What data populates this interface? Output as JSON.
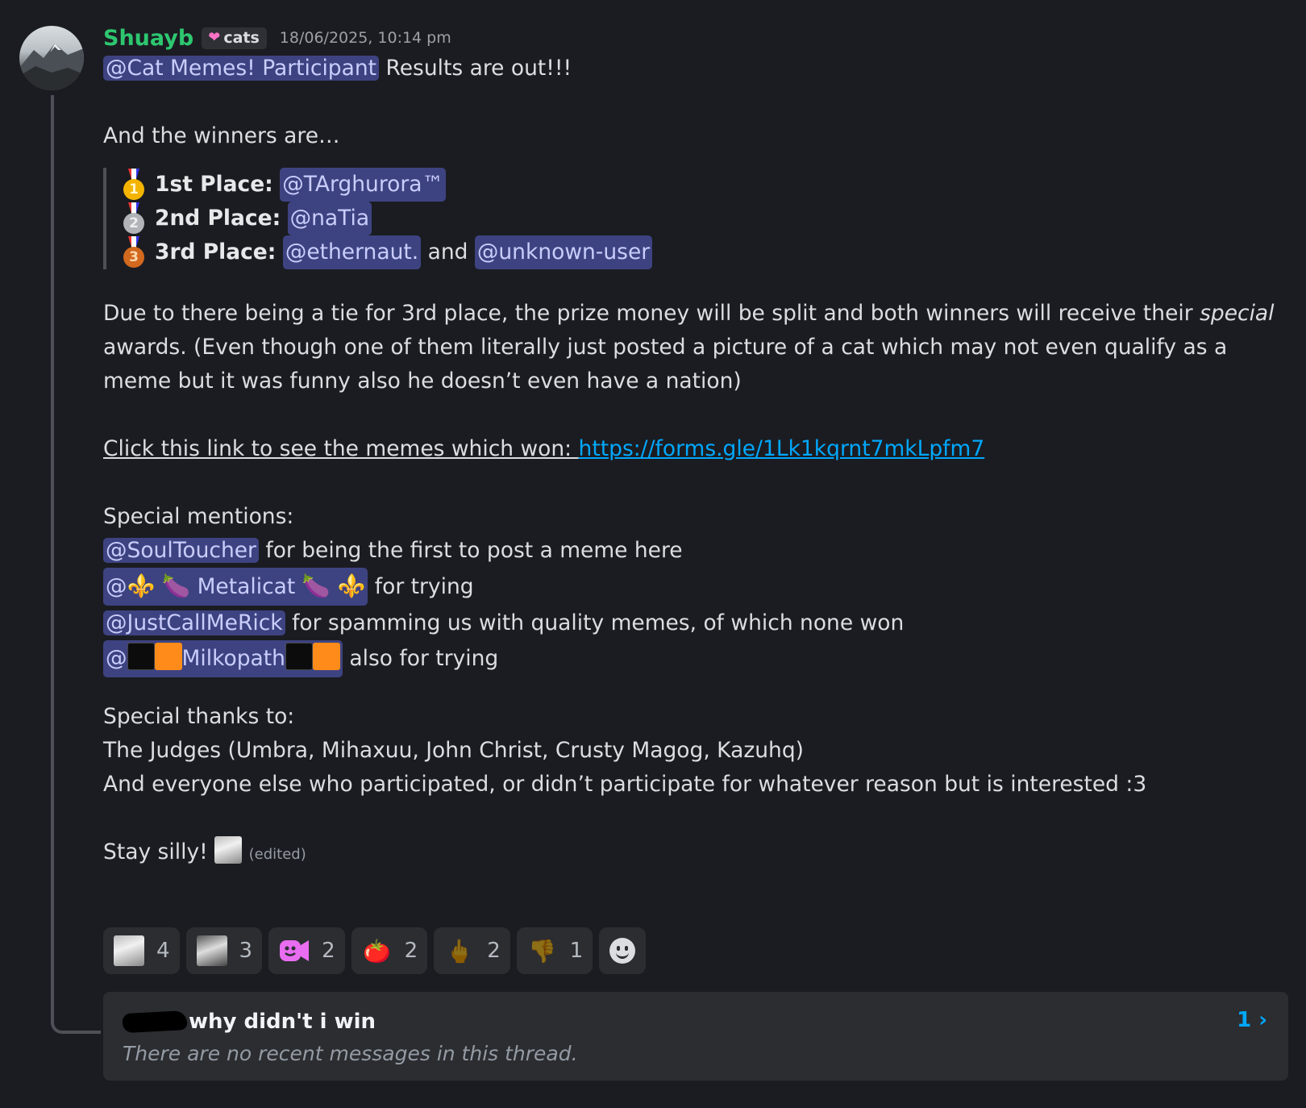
{
  "author": {
    "name": "Shuayb",
    "tag": "cats",
    "timestamp": "18/06/2025, 10:14 pm"
  },
  "message": {
    "intro_mention": "@Cat Memes! Participant",
    "intro_text": " Results are out!!!",
    "winners_intro": "And the winners are…",
    "places": [
      {
        "medal": "1",
        "label": "1st Place:",
        "mention": "@TArghurora™"
      },
      {
        "medal": "2",
        "label": "2nd Place:",
        "mention": "@naTia"
      },
      {
        "medal": "3",
        "label": "3rd Place:",
        "mention": "@ethernaut.",
        "joiner": " and ",
        "mention2": "@unknown-user"
      }
    ],
    "tie_text_1": "Due to there being a tie for 3rd place, the prize money will be split and both winners will receive their ",
    "tie_italic": "special",
    "tie_text_2": "awards. (Even though one of them literally just posted a picture of a cat which may not even qualify as a",
    "tie_text_3": "meme but it was funny also he doesn’t even have a nation)",
    "link_prefix": "Click this link to see the memes which won: ",
    "link_url": "https://forms.gle/1Lk1kqrnt7mkLpfm7",
    "special_mentions_heading": "Special mentions:",
    "mentions": [
      {
        "mention": "@SoulToucher",
        "text": " for being the first to post a meme here"
      },
      {
        "mention_prefix": "@",
        "mention_glyph": "⚜️ 🍆",
        "mention_name": " Metalicat ",
        "mention_glyph2": "🍆 ⚜️",
        "text": " for trying"
      },
      {
        "mention": "@JustCallMeRick",
        "text": " for spamming us with quality memes, of which none won"
      },
      {
        "mention_prefix": "@",
        "mention_name": "Milkopath",
        "text": " also for trying"
      }
    ],
    "thanks_heading": "Special thanks to:",
    "thanks_judges": "The Judges (Umbra, Mihaxuu, John Christ, Crusty Magog, Kazuhq)",
    "thanks_everyone": "And everyone else who participated, or didn’t participate for whatever reason but is interested :3",
    "signoff": "Stay silly! ",
    "edited": "(edited)"
  },
  "reactions": [
    {
      "icon": "cat-emote-icon",
      "count": "4"
    },
    {
      "icon": "cat-photo-icon",
      "count": "3"
    },
    {
      "icon": "pink-blob-icon",
      "count": "2"
    },
    {
      "icon": "tomato-icon",
      "count": "2",
      "glyph": "🍅"
    },
    {
      "icon": "middle-finger-icon",
      "count": "2",
      "glyph": "🖕"
    },
    {
      "icon": "thumbs-down-icon",
      "count": "1",
      "glyph": "👎"
    }
  ],
  "thread": {
    "title": "why didn't i win",
    "subtitle": "There are no recent messages in this thread.",
    "count": "1 ›"
  }
}
